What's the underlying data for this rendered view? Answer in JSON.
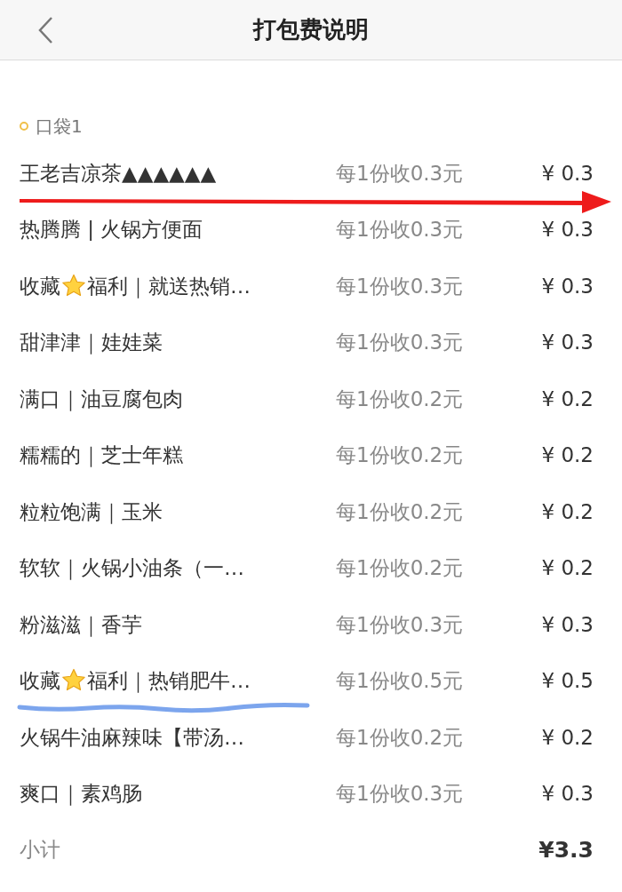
{
  "header": {
    "title": "打包费说明"
  },
  "pocket": {
    "label": "口袋1"
  },
  "items": [
    {
      "name": [
        "王老吉凉茶▲▲▲▲▲▲"
      ],
      "fee": "每1份收0.3元",
      "price": "¥ 0.3"
    },
    {
      "name": [
        "热腾腾 | 火锅方便面"
      ],
      "fee": "每1份收0.3元",
      "price": "¥ 0.3"
    },
    {
      "name": [
        "收藏",
        "福利｜就送热销…"
      ],
      "fee": "每1份收0.3元",
      "price": "¥ 0.3"
    },
    {
      "name": [
        "甜津津｜娃娃菜"
      ],
      "fee": "每1份收0.3元",
      "price": "¥ 0.3"
    },
    {
      "name": [
        "满口｜油豆腐包肉"
      ],
      "fee": "每1份收0.2元",
      "price": "¥ 0.2"
    },
    {
      "name": [
        "糯糯的｜芝士年糕"
      ],
      "fee": "每1份收0.2元",
      "price": "¥ 0.2"
    },
    {
      "name": [
        "粒粒饱满｜玉米"
      ],
      "fee": "每1份收0.2元",
      "price": "¥ 0.2"
    },
    {
      "name": [
        "软软｜火锅小油条（一…"
      ],
      "fee": "每1份收0.2元",
      "price": "¥ 0.2"
    },
    {
      "name": [
        "粉滋滋｜香芋"
      ],
      "fee": "每1份收0.3元",
      "price": "¥ 0.3"
    },
    {
      "name": [
        "收藏",
        "福利｜热销肥牛…"
      ],
      "fee": "每1份收0.5元",
      "price": "¥ 0.5"
    },
    {
      "name": [
        "火锅牛油麻辣味【带汤…"
      ],
      "fee": "每1份收0.2元",
      "price": "¥ 0.2"
    },
    {
      "name": [
        "爽口｜素鸡肠"
      ],
      "fee": "每1份收0.3元",
      "price": "¥ 0.3"
    }
  ],
  "subtotal": {
    "label": "小计",
    "value": "¥3.3"
  }
}
